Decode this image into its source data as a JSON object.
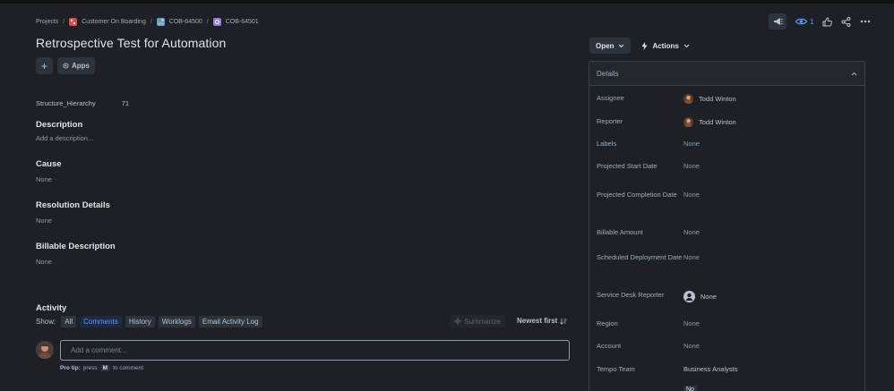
{
  "breadcrumb": {
    "projects": "Projects",
    "project": "Customer On Boarding",
    "parent": "COB-64500",
    "current": "COB-64501"
  },
  "header": {
    "watch_count": "1"
  },
  "issue": {
    "title": "Retrospective Test for Automation",
    "apps_label": "Apps"
  },
  "fields": {
    "structure_label": "Structure_Hierarchy",
    "structure_value": "71"
  },
  "sections": {
    "description_h": "Description",
    "description_v": "Add a description...",
    "cause_h": "Cause",
    "cause_v": "None",
    "resolution_h": "Resolution Details",
    "resolution_v": "None",
    "billable_h": "Billable Description",
    "billable_v": "None"
  },
  "activity": {
    "title": "Activity",
    "show_label": "Show:",
    "filters": [
      "All",
      "Comments",
      "History",
      "Worklogs",
      "Email Activity Log"
    ],
    "active_filter": "Comments",
    "summarize": "Summarize",
    "sort": "Newest first",
    "comment_placeholder": "Add a comment...",
    "protip_prefix": "Pro tip:",
    "protip_press": "press",
    "protip_key": "M",
    "protip_suffix": "to comment"
  },
  "status": {
    "open": "Open",
    "actions": "Actions"
  },
  "details": {
    "heading": "Details",
    "rows": [
      {
        "label": "Assignee",
        "value": "Todd Winton"
      },
      {
        "label": "Reporter",
        "value": "Todd Winton"
      },
      {
        "label": "Labels",
        "value": "None"
      },
      {
        "label": "Projected Start Date",
        "value": "None"
      },
      {
        "label": "Projected Completion Date",
        "value": "None"
      },
      {
        "label": "Billable Amount",
        "value": "None"
      },
      {
        "label": "Scheduled Deployment Date",
        "value": "None"
      },
      {
        "label": "Service Desk Reporter",
        "value": "None"
      },
      {
        "label": "Region",
        "value": "None"
      },
      {
        "label": "Account",
        "value": "None"
      },
      {
        "label": "Tempo Team",
        "value": "Business Analysts"
      }
    ],
    "cut_value": "No"
  },
  "colors": {
    "accent": "#579dff",
    "background": "#1d2125"
  }
}
